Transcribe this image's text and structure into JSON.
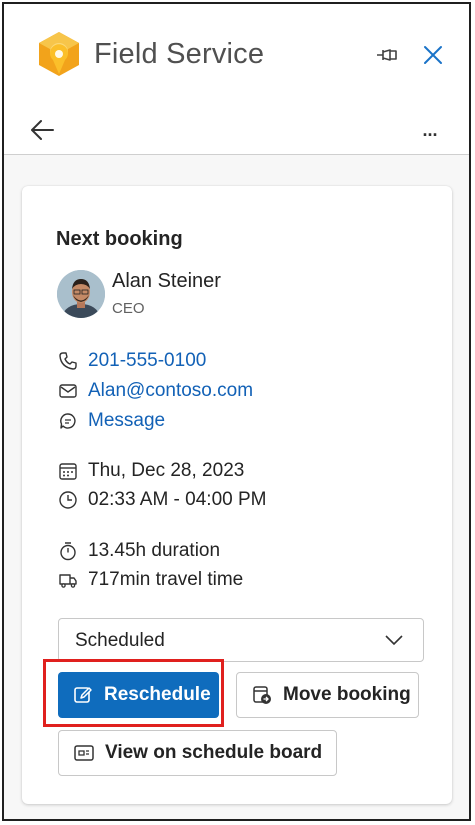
{
  "app": {
    "title": "Field Service"
  },
  "header": {
    "more_label": "..."
  },
  "booking": {
    "section_title": "Next booking",
    "contact": {
      "name": "Alan Steiner",
      "role": "CEO"
    },
    "phone": "201-555-0100",
    "email": "Alan@contoso.com",
    "message": "Message",
    "date": "Thu, Dec 28, 2023",
    "time": "02:33 AM - 04:00 PM",
    "duration": "13.45h duration",
    "travel": "717min travel time",
    "status": {
      "selected": "Scheduled"
    }
  },
  "actions": {
    "reschedule": "Reschedule",
    "move_booking": "Move booking",
    "schedule_board": "View on schedule board"
  },
  "icons": [
    "field-service-logo",
    "pin-icon",
    "close-icon",
    "back-arrow-icon",
    "more-icon",
    "phone-icon",
    "mail-icon",
    "chat-icon",
    "calendar-icon",
    "clock-icon",
    "timer-icon",
    "truck-icon",
    "chevron-down-icon",
    "edit-icon",
    "move-icon",
    "board-icon"
  ],
  "colors": {
    "primary": "#0f6cbd",
    "link": "#1261b6",
    "highlight": "#e0201e",
    "logo_orange": "#f2a31b"
  }
}
